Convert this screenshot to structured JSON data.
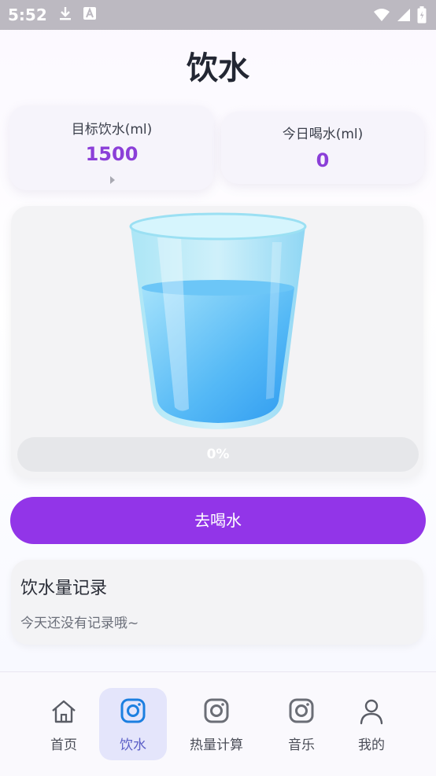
{
  "status": {
    "time": "5:52"
  },
  "page": {
    "title": "饮水"
  },
  "target": {
    "label": "目标饮水(ml)",
    "value": "1500"
  },
  "today": {
    "label": "今日喝水(ml)",
    "value": "0"
  },
  "progress": {
    "fraction": 0,
    "label": "0%"
  },
  "action": {
    "drink_label": "去喝水"
  },
  "records": {
    "title": "饮水量记录",
    "empty_text": "今天还没有记录哦~"
  },
  "nav": {
    "items": [
      {
        "label": "首页",
        "icon": "home-icon"
      },
      {
        "label": "饮水",
        "icon": "camera-icon",
        "active": true
      },
      {
        "label": "热量计算",
        "icon": "camera-icon"
      },
      {
        "label": "音乐",
        "icon": "camera-icon"
      },
      {
        "label": "我的",
        "icon": "person-icon"
      }
    ]
  },
  "colors": {
    "accent": "#9235e8",
    "value": "#8b3fd8",
    "active_nav": "#5b5fc7",
    "water": "#4fb4f5"
  }
}
